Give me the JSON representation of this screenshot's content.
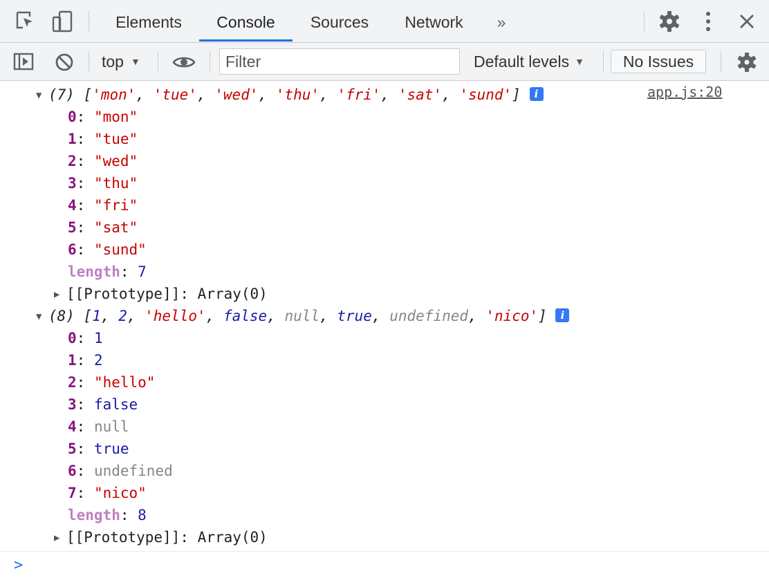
{
  "tabs": [
    {
      "label": "Elements"
    },
    {
      "label": "Console"
    },
    {
      "label": "Sources"
    },
    {
      "label": "Network"
    }
  ],
  "more_tabs_glyph": "»",
  "toolbar": {
    "context": "top",
    "filter_placeholder": "Filter",
    "levels": "Default levels",
    "issues": "No Issues"
  },
  "colors": {
    "accent": "#1a73e8",
    "string": "#c80000",
    "number": "#1a1aa6",
    "key": "#881280"
  },
  "log1": {
    "source": "app.js:20",
    "count": "(7)",
    "items": [
      "'mon'",
      "'tue'",
      "'wed'",
      "'thu'",
      "'fri'",
      "'sat'",
      "'sund'"
    ],
    "entries": [
      {
        "k": "0",
        "v": "\"mon\""
      },
      {
        "k": "1",
        "v": "\"tue\""
      },
      {
        "k": "2",
        "v": "\"wed\""
      },
      {
        "k": "3",
        "v": "\"thu\""
      },
      {
        "k": "4",
        "v": "\"fri\""
      },
      {
        "k": "5",
        "v": "\"sat\""
      },
      {
        "k": "6",
        "v": "\"sund\""
      }
    ],
    "length_key": "length",
    "length": "7",
    "proto": "[[Prototype]]",
    "proto_val": "Array(0)"
  },
  "log2": {
    "count": "(8)",
    "items": [
      "1",
      "2",
      "'hello'",
      "false",
      "null",
      "true",
      "undefined",
      "'nico'"
    ],
    "entries": [
      {
        "k": "0",
        "v": "1"
      },
      {
        "k": "1",
        "v": "2"
      },
      {
        "k": "2",
        "v": "\"hello\""
      },
      {
        "k": "3",
        "v": "false"
      },
      {
        "k": "4",
        "v": "null"
      },
      {
        "k": "5",
        "v": "true"
      },
      {
        "k": "6",
        "v": "undefined"
      },
      {
        "k": "7",
        "v": "\"nico\""
      }
    ],
    "length_key": "length",
    "length": "8",
    "proto": "[[Prototype]]",
    "proto_val": "Array(0)"
  },
  "prompt": ">"
}
